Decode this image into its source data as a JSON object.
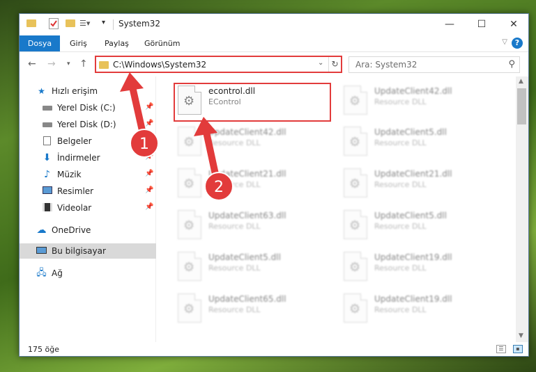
{
  "window": {
    "title": "System32",
    "controls": {
      "minimize": "—",
      "maximize": "☐",
      "close": "✕"
    }
  },
  "quick_access_icons": [
    "folder-icon",
    "properties-icon",
    "new-folder-icon",
    "customize-arrow-icon"
  ],
  "ribbon": {
    "tabs": [
      "Dosya",
      "Giriş",
      "Paylaş",
      "Görünüm"
    ],
    "help_label": "?"
  },
  "navigation": {
    "address": "C:\\Windows\\System32",
    "search_placeholder": "Ara: System32"
  },
  "sidebar": {
    "items": [
      {
        "label": "Hızlı erişim",
        "icon": "star-icon",
        "pinned": false
      },
      {
        "label": "Yerel Disk (C:)",
        "icon": "drive-icon",
        "pinned": true
      },
      {
        "label": "Yerel Disk (D:)",
        "icon": "drive-icon",
        "pinned": true
      },
      {
        "label": "Belgeler",
        "icon": "documents-icon",
        "pinned": true
      },
      {
        "label": "İndirmeler",
        "icon": "download-icon",
        "pinned": true
      },
      {
        "label": "Müzik",
        "icon": "music-icon",
        "pinned": true
      },
      {
        "label": "Resimler",
        "icon": "pictures-icon",
        "pinned": true
      },
      {
        "label": "Videolar",
        "icon": "videos-icon",
        "pinned": true
      },
      {
        "label": "OneDrive",
        "icon": "cloud-icon",
        "pinned": false
      },
      {
        "label": "Bu bilgisayar",
        "icon": "computer-icon",
        "pinned": false,
        "selected": true
      },
      {
        "label": "Ağ",
        "icon": "network-icon",
        "pinned": false
      }
    ]
  },
  "files": {
    "left": [
      {
        "name": "econtrol.dll",
        "desc": "EControl"
      },
      {
        "name": "UpdateClient42.dll",
        "desc": "Resource DLL"
      },
      {
        "name": "UpdateClient21.dll",
        "desc": "Resource DLL"
      },
      {
        "name": "UpdateClient63.dll",
        "desc": "Resource DLL"
      },
      {
        "name": "UpdateClient5.dll",
        "desc": "Resource DLL"
      },
      {
        "name": "UpdateClient65.dll",
        "desc": "Resource DLL"
      }
    ],
    "right": [
      {
        "name": "UpdateClient42.dll",
        "desc": "Resource DLL"
      },
      {
        "name": "UpdateClient5.dll",
        "desc": "Resource DLL"
      },
      {
        "name": "UpdateClient21.dll",
        "desc": "Resource DLL"
      },
      {
        "name": "UpdateClient5.dll",
        "desc": "Resource DLL"
      },
      {
        "name": "UpdateClient19.dll",
        "desc": "Resource DLL"
      },
      {
        "name": "UpdateClient19.dll",
        "desc": "Resource DLL"
      }
    ]
  },
  "status": {
    "count": "175 öğe"
  },
  "annotations": {
    "step1": "1",
    "step2": "2",
    "color": "#e23b3b"
  }
}
